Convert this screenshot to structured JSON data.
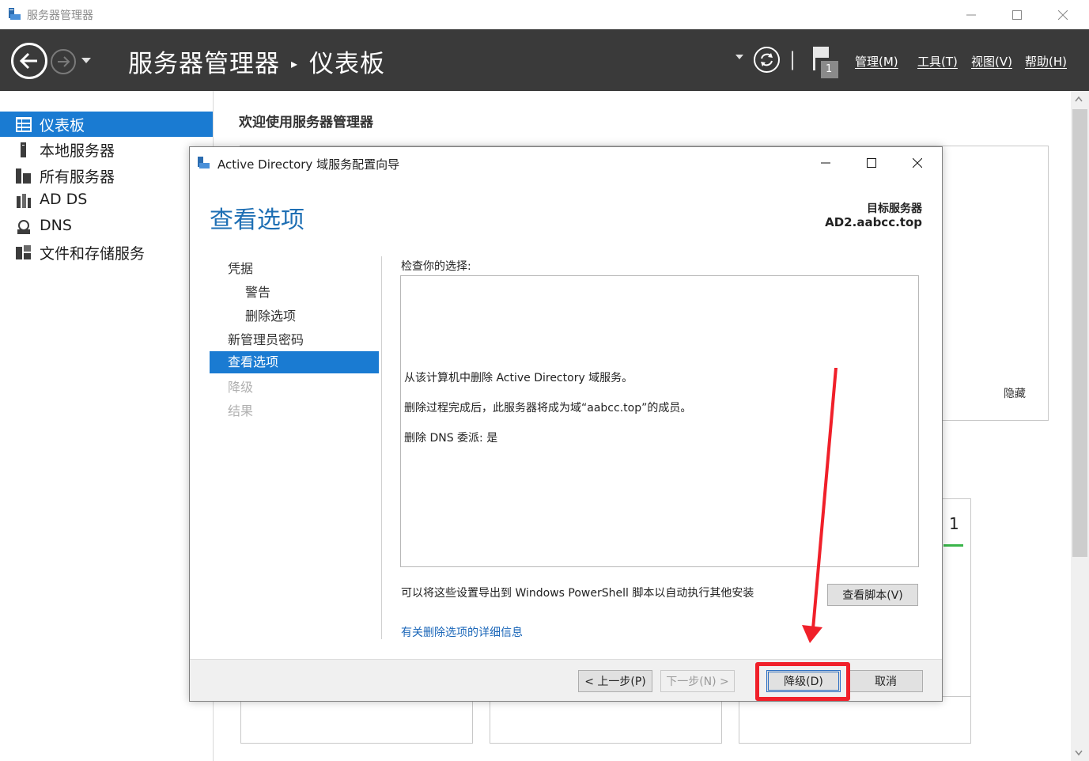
{
  "window": {
    "title": "服务器管理器"
  },
  "header": {
    "breadcrumb_root": "服务器管理器",
    "breadcrumb_page": "仪表板",
    "separator": "▸",
    "divider": "|",
    "notification_count": "1",
    "menus": [
      "管理(M)",
      "工具(T)",
      "视图(V)",
      "帮助(H)"
    ]
  },
  "sidebar": {
    "items": [
      {
        "label": "仪表板",
        "icon": "dashboard-icon"
      },
      {
        "label": "本地服务器",
        "icon": "server-icon"
      },
      {
        "label": "所有服务器",
        "icon": "servers-icon"
      },
      {
        "label": "AD DS",
        "icon": "ad-ds-icon"
      },
      {
        "label": "DNS",
        "icon": "dns-icon"
      },
      {
        "label": "文件和存储服务",
        "icon": "storage-icon"
      }
    ]
  },
  "main": {
    "welcome": "欢迎使用服务器管理器",
    "hide_link": "隐藏",
    "tile_count": "1"
  },
  "dialog": {
    "title": "Active Directory 域服务配置向导",
    "heading": "查看选项",
    "target_label": "目标服务器",
    "target_value": "AD2.aabcc.top",
    "steps": [
      {
        "label": "凭据",
        "state": "normal",
        "level": "top"
      },
      {
        "label": "警告",
        "state": "normal",
        "level": "sub"
      },
      {
        "label": "删除选项",
        "state": "normal",
        "level": "sub"
      },
      {
        "label": "新管理员密码",
        "state": "normal",
        "level": "top"
      },
      {
        "label": "查看选项",
        "state": "active",
        "level": "top"
      },
      {
        "label": "降级",
        "state": "disabled",
        "level": "top"
      },
      {
        "label": "结果",
        "state": "disabled",
        "level": "top"
      }
    ],
    "check_label": "检查你的选择:",
    "review_lines": [
      "从该计算机中删除 Active Directory 域服务。",
      "删除过程完成后，此服务器将成为域“aabcc.top”的成员。",
      "删除 DNS 委派: 是"
    ],
    "export_text": "可以将这些设置导出到 Windows PowerShell 脚本以自动执行其他安装",
    "view_script_button": "查看脚本(V)",
    "info_link": "有关删除选项的详细信息",
    "buttons": {
      "previous": "< 上一步(P)",
      "next": "下一步(N) >",
      "demote": "降级(D)",
      "cancel": "取消"
    }
  },
  "annotation": {
    "highlight_color": "#f0202a"
  },
  "colors": {
    "accent": "#1a7bd2",
    "header_bg": "#3a3a3a",
    "link": "#1a66b8",
    "heading": "#1e6fb4"
  }
}
